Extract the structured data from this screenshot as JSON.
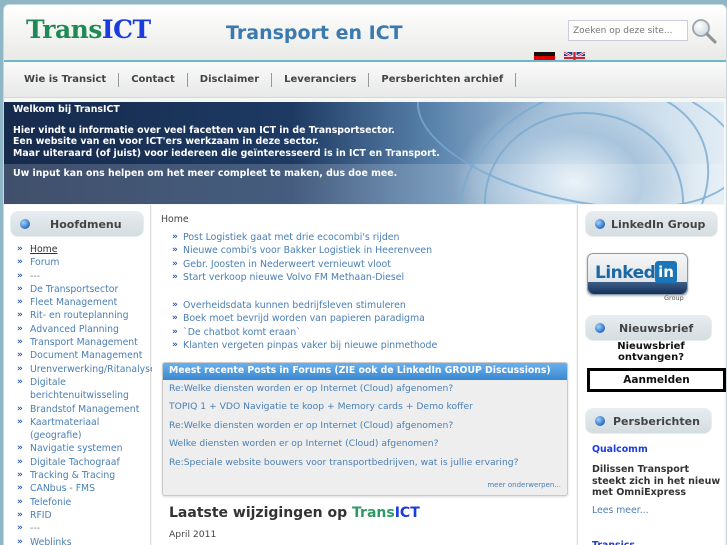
{
  "header": {
    "logo_trans": "Trans",
    "logo_ict": "ICT",
    "site_title": "Transport en ICT",
    "search_placeholder": "Zoeken op deze site...",
    "search_icon": "magnifier-icon",
    "languages": [
      "Deutsch",
      "English"
    ]
  },
  "nav": {
    "items": [
      "Wie is Transict",
      "Contact",
      "Disclaimer",
      "Leveranciers",
      "Persberichten archief"
    ]
  },
  "banner": {
    "title": "Welkom bij TransICT",
    "lines": [
      "Hier vindt u informatie over veel facetten van ICT in de Transportsector.",
      "Een website van en voor ICT'ers werkzaam in deze sector.",
      "Maar uiteraard (of juist) voor iedereen die geïnteresseerd is in ICT en Transport."
    ],
    "call_to_action": "Uw input kan ons helpen om het meer compleet te maken, dus doe mee."
  },
  "left_sidebar": {
    "title": "Hoofdmenu",
    "items": [
      "Home",
      "Forum",
      "---",
      "De Transportsector",
      "Fleet Management",
      "Rit- en routeplanning",
      "Advanced Planning",
      "Transport Management",
      "Document Management",
      "Urenverwerking/Ritanalyse",
      "Digitale berichtenuitwisseling",
      "Brandstof Management",
      "Kaartmateriaal (geografie)",
      "Navigatie systemen",
      "Digitale Tachograaf",
      "Tracking & Tracing",
      "CANbus - FMS",
      "Telefonie",
      "RFID",
      "---",
      "Weblinks"
    ],
    "active_index": 0
  },
  "main": {
    "breadcrumb": "Home",
    "news_group_1": [
      "Post Logistiek gaat met drie ecocombi's rijden",
      "Nieuwe combi's voor Bakker Logistiek in Heerenveen",
      "Gebr. Joosten in Nederweert vernieuwt vloot",
      "Start verkoop nieuwe Volvo FM Methaan-Diesel"
    ],
    "news_group_2": [
      "Overheidsdata kunnen bedrijfsleven stimuleren",
      "Boek moet bevrijd worden van papieren paradigma",
      "`De chatbot komt eraan`",
      "Klanten vergeten pinpas vaker bij nieuwe pinmethode"
    ],
    "forum": {
      "title": "Meest recente Posts in Forums (ZIE ook de LinkedIn GROUP Discussions)",
      "posts": [
        "Re:Welke diensten worden er op Internet (Cloud) afgenomen?",
        "TOPIQ 1 + VDO Navigatie te koop + Memory cards + Demo koffer",
        "Re:Welke diensten worden er op Internet (Cloud) afgenomen?",
        "Welke diensten worden er op Internet (Cloud) afgenomen?",
        "Re:Speciale website bouwers voor transportbedrijven, wat is jullie ervaring?"
      ],
      "more": "meer onderwerpen..."
    },
    "latest": {
      "title_prefix": "Laatste wijzigingen op ",
      "title_trans": "Trans",
      "title_ict": "ICT",
      "date": "April 2011"
    }
  },
  "right_sidebar": {
    "linkedin": {
      "title": "LinkedIn Group",
      "logo_linked": "Linked",
      "logo_in": "in",
      "logo_group": "Group"
    },
    "newsletter": {
      "title": "Nieuwsbrief",
      "question": "Nieuwsbrief ontvangen?",
      "button": "Aanmelden"
    },
    "press": {
      "title": "Persberichten",
      "items": [
        {
          "company": "Qualcomm",
          "text": "Dilissen Transport steekt zich in het nieuw met OmniExpress",
          "more": "Lees meer..."
        },
        {
          "company": "Transics"
        }
      ]
    }
  },
  "colors": {
    "logo_green": "#1f8a55",
    "logo_blue": "#1a3cdc",
    "title_blue": "#3a7ab0",
    "link_blue": "#4a7fb5",
    "forum_header": "#4a96dc",
    "page_bg": "#8fb6c4"
  }
}
